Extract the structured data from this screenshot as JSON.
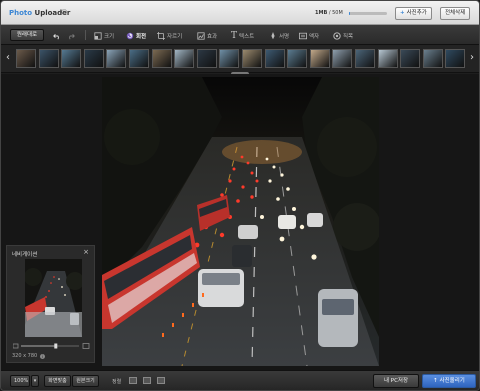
{
  "app": {
    "title_part1": "Photo",
    "title_part2": " Uploader",
    "version_mark": "☺"
  },
  "header": {
    "quota_used": "1MB",
    "quota_total": " / 50M",
    "quota_fraction": 0.02,
    "add_photo_label": "사진추가",
    "delete_all_label": "전체삭제"
  },
  "toolbar": {
    "original_label": "원래대로",
    "tools": [
      {
        "name": "resize",
        "label": "크기"
      },
      {
        "name": "rotate",
        "label": "회전"
      },
      {
        "name": "crop",
        "label": "자르기"
      },
      {
        "name": "effect",
        "label": "효과"
      },
      {
        "name": "text",
        "label": "텍스트"
      },
      {
        "name": "signature",
        "label": "서명"
      },
      {
        "name": "frame",
        "label": "액자"
      },
      {
        "name": "mosaic",
        "label": "직목"
      }
    ],
    "active_tool": "rotate"
  },
  "filmstrip": {
    "thumbnails": [
      {
        "color": "#6b5a4a"
      },
      {
        "color": "#3b5368"
      },
      {
        "color": "#567a93"
      },
      {
        "color": "#2a3a48"
      },
      {
        "color": "#8aa4b8"
      },
      {
        "color": "#4a6d86"
      },
      {
        "color": "#7b6a52"
      },
      {
        "color": "#a2b6c4"
      },
      {
        "color": "#2c3844"
      },
      {
        "color": "#6f8fa6"
      },
      {
        "color": "#9b8a6e"
      },
      {
        "color": "#3d5a72"
      },
      {
        "color": "#5b7b90"
      },
      {
        "color": "#c2a98a"
      },
      {
        "color": "#8e9fad"
      },
      {
        "color": "#4b6579"
      },
      {
        "color": "#b7c7d3"
      },
      {
        "color": "#3a4a58"
      },
      {
        "color": "#6a7f8e"
      },
      {
        "color": "#2f4a60"
      }
    ]
  },
  "navigator": {
    "title": "네비게이션",
    "dimensions": "320 x 780",
    "zoom_fraction": 0.6
  },
  "bottombar": {
    "zoom_value": "100%",
    "fit_label": "화면맞춤",
    "actual_size_label": "원본크기",
    "sort_label": "정렬",
    "save_pc_label": "내 PC저장",
    "upload_label": "사진올리기"
  }
}
